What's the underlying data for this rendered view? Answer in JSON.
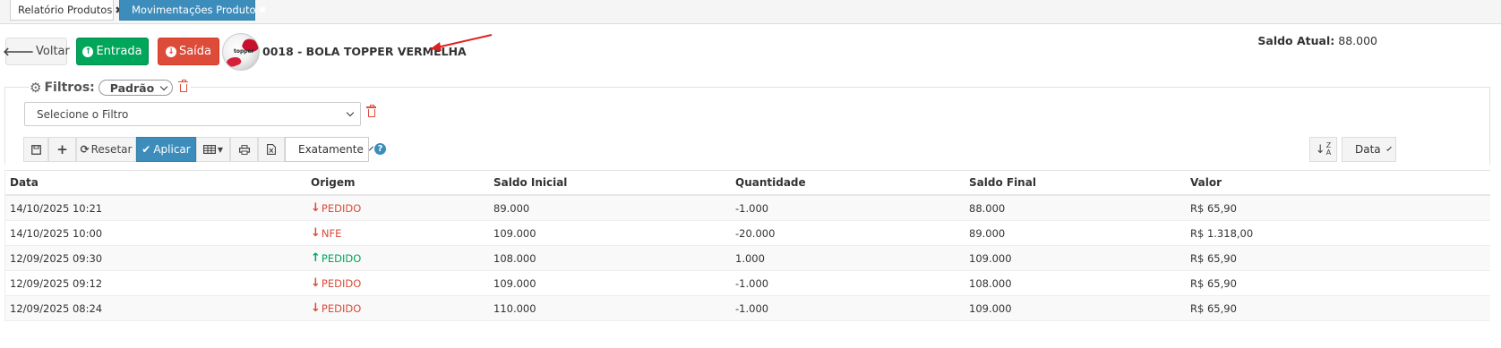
{
  "tabs": [
    {
      "label": "Relatório Produtos",
      "active": false
    },
    {
      "label": "Movimentações Produto",
      "active": true
    }
  ],
  "actions": {
    "back_label": "Voltar",
    "entrada_label": "Entrada",
    "saida_label": "Saída"
  },
  "product": {
    "title": "0018 - BOLA TOPPER VERMELHA",
    "image_label": "topper"
  },
  "saldo": {
    "label": "Saldo Atual:",
    "value": "88.000"
  },
  "filters": {
    "title": "Filtros:",
    "preset": "Padrão",
    "select_placeholder": "Selecione o Filtro",
    "reset_label": "Resetar",
    "apply_label": "Aplicar",
    "match_mode": "Exatamente",
    "sort_field": "Data"
  },
  "colors": {
    "primary": "#3c8dbc",
    "success": "#00a65a",
    "danger": "#dd4b39"
  },
  "table": {
    "columns": [
      "Data",
      "Origem",
      "Saldo Inicial",
      "Quantidade",
      "Saldo Final",
      "Valor"
    ],
    "rows": [
      {
        "data": "14/10/2025 10:21",
        "origem": "PEDIDO",
        "direction": "down",
        "saldo_inicial": "89.000",
        "quantidade": "-1.000",
        "saldo_final": "88.000",
        "valor": "R$ 65,90"
      },
      {
        "data": "14/10/2025 10:00",
        "origem": "NFE",
        "direction": "down",
        "saldo_inicial": "109.000",
        "quantidade": "-20.000",
        "saldo_final": "89.000",
        "valor": "R$ 1.318,00"
      },
      {
        "data": "12/09/2025 09:30",
        "origem": "PEDIDO",
        "direction": "up",
        "saldo_inicial": "108.000",
        "quantidade": "1.000",
        "saldo_final": "109.000",
        "valor": "R$ 65,90"
      },
      {
        "data": "12/09/2025 09:12",
        "origem": "PEDIDO",
        "direction": "down",
        "saldo_inicial": "109.000",
        "quantidade": "-1.000",
        "saldo_final": "108.000",
        "valor": "R$ 65,90"
      },
      {
        "data": "12/09/2025 08:24",
        "origem": "PEDIDO",
        "direction": "down",
        "saldo_inicial": "110.000",
        "quantidade": "-1.000",
        "saldo_final": "109.000",
        "valor": "R$ 65,90"
      }
    ]
  }
}
